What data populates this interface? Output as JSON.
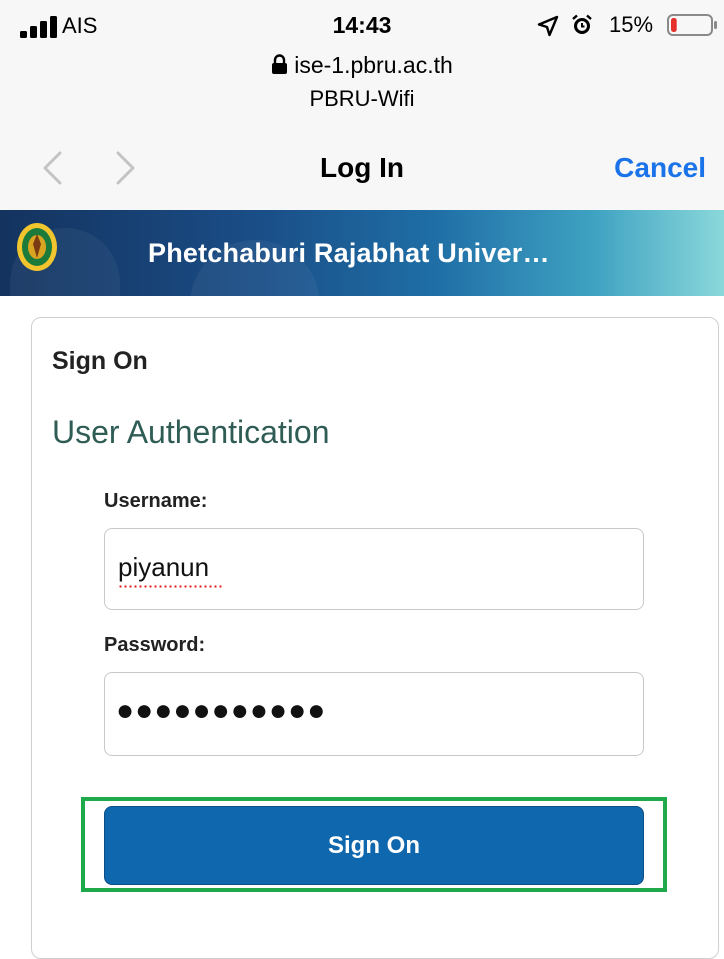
{
  "status_bar": {
    "carrier": "AIS",
    "time": "14:43",
    "battery_percent": "15%",
    "battery_level": 0.15,
    "battery_color": "#e5302b"
  },
  "browser": {
    "url": "ise-1.pbru.ac.th",
    "ssid": "PBRU-Wifi"
  },
  "nav": {
    "title": "Log In",
    "cancel_label": "Cancel",
    "accent_color": "#1a73e8"
  },
  "banner": {
    "title": "Phetchaburi Rajabhat Univer…"
  },
  "card": {
    "title": "Sign On",
    "heading": "User Authentication",
    "username_label": "Username:",
    "username_value": "piyanun",
    "password_label": "Password:",
    "password_mask": "●●●●●●●●●●●",
    "submit_label": "Sign On",
    "button_color": "#0f67ae",
    "highlight_color": "#1eaa4a"
  },
  "icons": [
    "signal-icon",
    "location-arrow-icon",
    "alarm-clock-icon",
    "battery-icon",
    "lock-icon",
    "back-chevron-icon",
    "forward-chevron-icon",
    "university-seal-icon"
  ]
}
